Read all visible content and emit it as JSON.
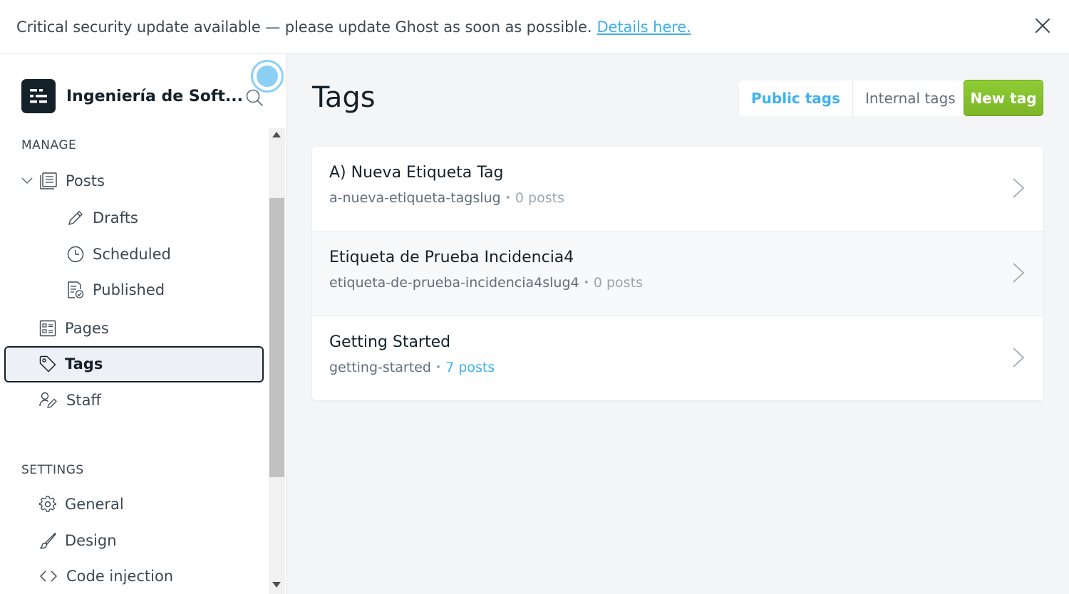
{
  "banner": {
    "text": "Critical security update available — please update Ghost as soon as possible.",
    "link": "Details here."
  },
  "sidebar": {
    "brand": "Ingeniería de Soft...",
    "sections": {
      "manage": "MANAGE",
      "settings": "SETTINGS"
    },
    "items": {
      "posts": "Posts",
      "drafts": "Drafts",
      "scheduled": "Scheduled",
      "published": "Published",
      "pages": "Pages",
      "tags": "Tags",
      "staff": "Staff",
      "general": "General",
      "design": "Design",
      "code_injection": "Code injection"
    }
  },
  "main": {
    "title": "Tags",
    "tabs": [
      "Public tags",
      "Internal tags"
    ],
    "active_tab": "Public tags",
    "new_tag": "New tag",
    "tags": [
      {
        "name": "A) Nueva Etiqueta Tag",
        "slug": "a-nueva-etiqueta-tagslug",
        "count": "0 posts"
      },
      {
        "name": "Etiqueta de Prueba Incidencia4",
        "slug": "etiqueta-de-prueba-incidencia4slug4",
        "count": "0 posts"
      },
      {
        "name": "Getting Started",
        "slug": "getting-started",
        "count": "7 posts"
      }
    ]
  },
  "colors": {
    "accent": "#3eb0ef",
    "green": "#7bb627",
    "dark": "#15212a"
  }
}
